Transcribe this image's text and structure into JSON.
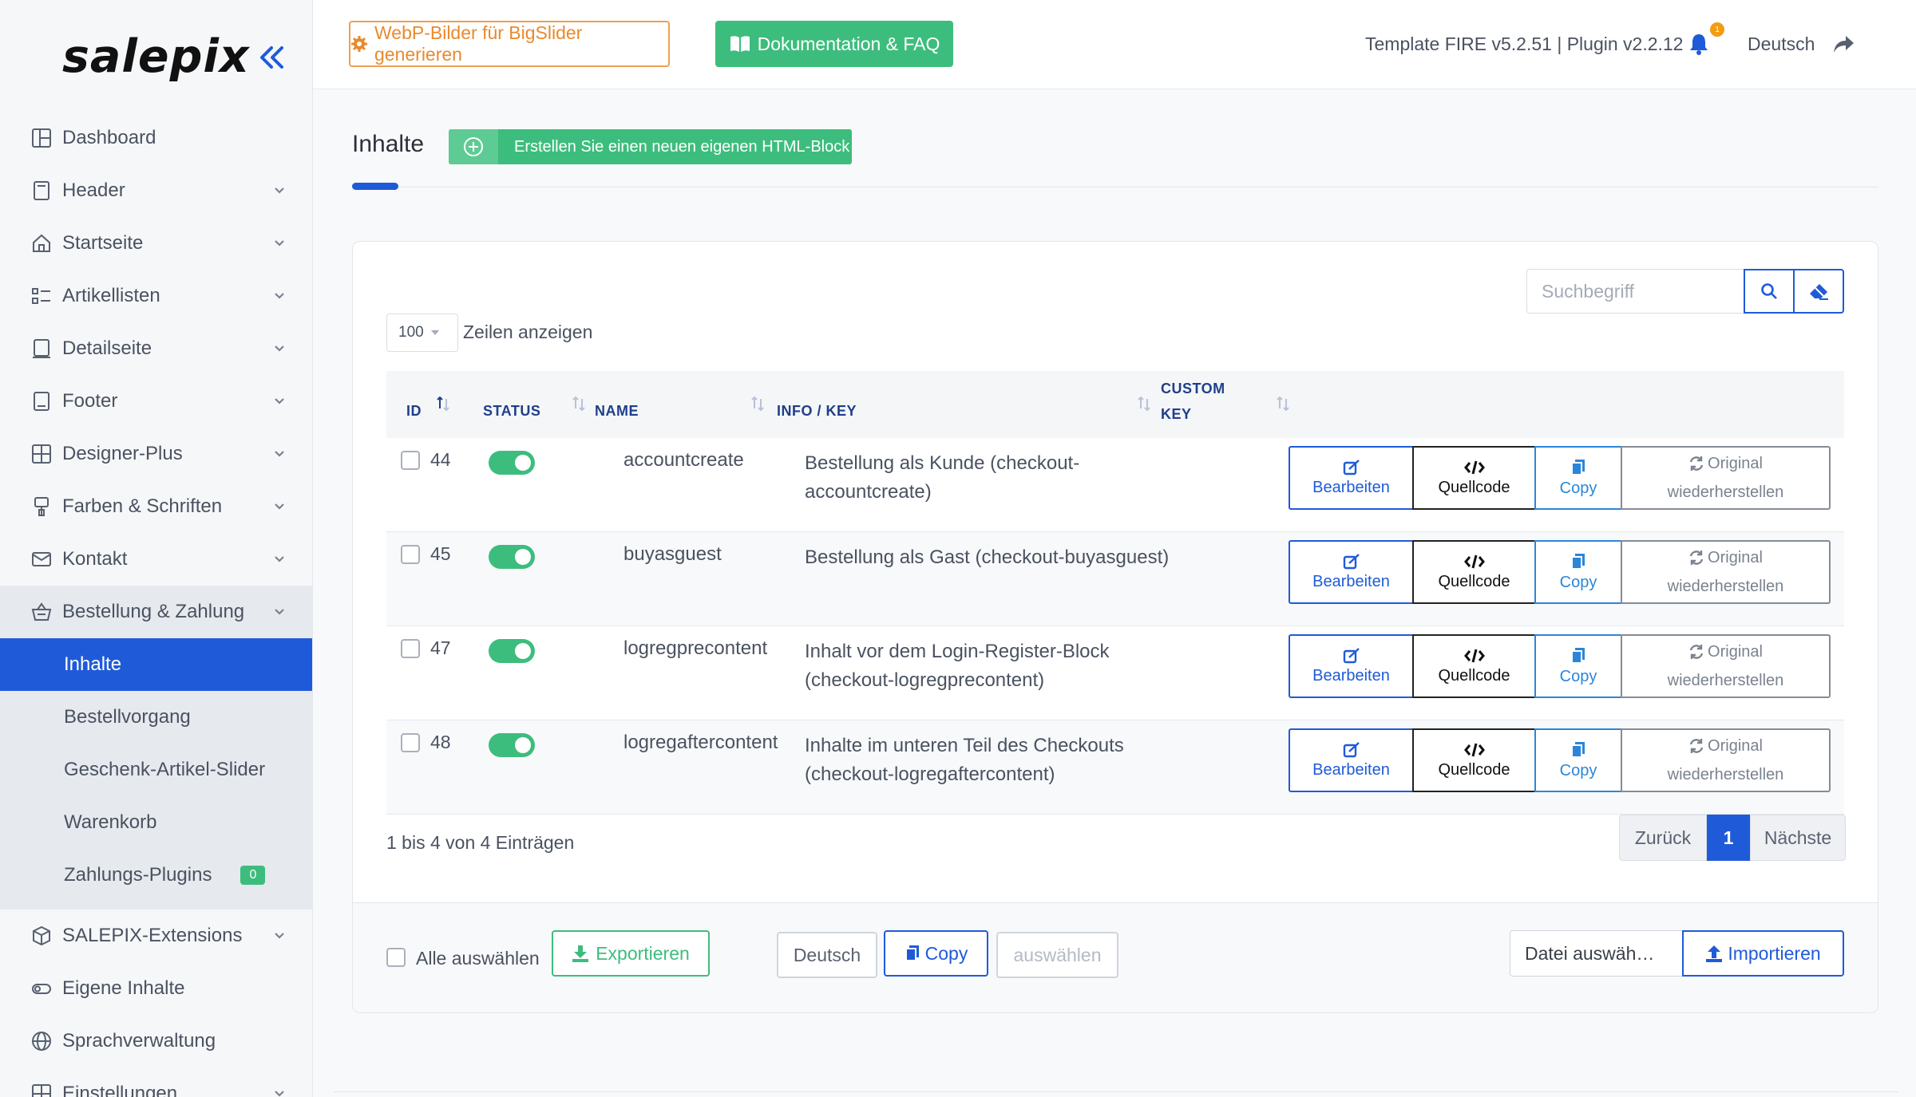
{
  "brand": {
    "logo_text": "salepix"
  },
  "sidebar": {
    "items": [
      {
        "label": "Dashboard",
        "icon": "dashboard-icon",
        "has_chevron": false
      },
      {
        "label": "Header",
        "icon": "header-icon",
        "has_chevron": true
      },
      {
        "label": "Startseite",
        "icon": "home-icon",
        "has_chevron": true
      },
      {
        "label": "Artikellisten",
        "icon": "list-icon",
        "has_chevron": true
      },
      {
        "label": "Detailseite",
        "icon": "detail-icon",
        "has_chevron": true
      },
      {
        "label": "Footer",
        "icon": "footer-icon",
        "has_chevron": true
      },
      {
        "label": "Designer-Plus",
        "icon": "grid-icon",
        "has_chevron": true
      },
      {
        "label": "Farben & Schriften",
        "icon": "paint-icon",
        "has_chevron": true
      },
      {
        "label": "Kontakt",
        "icon": "mail-icon",
        "has_chevron": true
      },
      {
        "label": "Bestellung & Zahlung",
        "icon": "basket-icon",
        "has_chevron": true,
        "open": true
      }
    ],
    "subitems": [
      {
        "label": "Inhalte",
        "active": true
      },
      {
        "label": "Bestellvorgang"
      },
      {
        "label": "Geschenk-Artikel-Slider"
      },
      {
        "label": "Warenkorb"
      },
      {
        "label": "Zahlungs-Plugins",
        "badge": "0"
      }
    ],
    "items_after": [
      {
        "label": "SALEPIX-Extensions",
        "icon": "cube-icon",
        "has_chevron": true
      },
      {
        "label": "Eigene Inhalte",
        "icon": "toggle-icon",
        "has_chevron": false
      },
      {
        "label": "Sprachverwaltung",
        "icon": "globe-icon",
        "has_chevron": false
      },
      {
        "label": "Einstellungen",
        "icon": "settings-grid-icon",
        "has_chevron": true
      }
    ]
  },
  "topbar": {
    "webp_button": "WebP-Bilder für BigSlider generieren",
    "doku_button": "Dokumentation & FAQ",
    "version": "Template FIRE v5.2.51 | Plugin v2.2.12",
    "notification_count": "1",
    "language": "Deutsch"
  },
  "page": {
    "title": "Inhalte",
    "create_button": "Erstellen Sie einen neuen eigenen HTML-Block"
  },
  "table_controls": {
    "rows_value": "100",
    "rows_label": "Zeilen anzeigen",
    "search_placeholder": "Suchbegriff"
  },
  "table": {
    "headers": {
      "id": "ID",
      "status": "STATUS",
      "name": "NAME",
      "info": "INFO / KEY",
      "custom_key_1": "CUSTOM",
      "custom_key_2": "KEY"
    },
    "action_labels": {
      "edit": "Bearbeiten",
      "code": "Quellcode",
      "copy": "Copy",
      "restore_1": "Original",
      "restore_2": "wiederherstellen"
    },
    "rows": [
      {
        "id": "44",
        "name": "accountcreate",
        "info": "Bestellung als Kunde (checkout-accountcreate)",
        "info_l1": "Bestellung als Kunde (checkout-",
        "info_l2": "accountcreate)",
        "status": "on"
      },
      {
        "id": "45",
        "name": "buyasguest",
        "info": "Bestellung als Gast (checkout-buyasguest)",
        "info_l1": "Bestellung als Gast (checkout-buyasguest)",
        "info_l2": "",
        "status": "on"
      },
      {
        "id": "47",
        "name": "logregprecontent",
        "info": "Inhalt vor dem Login-Register-Block (checkout-logregprecontent)",
        "info_l1": "Inhalt vor dem Login-Register-Block",
        "info_l2": "(checkout-logregprecontent)",
        "status": "on"
      },
      {
        "id": "48",
        "name": "logregaftercontent",
        "info": "Inhalte im unteren Teil des Checkouts (checkout-logregaftercontent)",
        "info_l1": "Inhalte im unteren Teil des Checkouts",
        "info_l2": "(checkout-logregaftercontent)",
        "status": "on"
      }
    ]
  },
  "pagination": {
    "info": "1 bis 4 von 4 Einträgen",
    "prev": "Zurück",
    "current": "1",
    "next": "Nächste"
  },
  "footer": {
    "select_all": "Alle auswählen",
    "export": "Exportieren",
    "language": "Deutsch",
    "copy": "Copy",
    "select": "auswählen",
    "file": "Datei auswäh…",
    "import": "Importieren"
  },
  "colors": {
    "primary": "#1f5bd9",
    "success": "#3dbd7d",
    "warning": "#e88a2c"
  }
}
